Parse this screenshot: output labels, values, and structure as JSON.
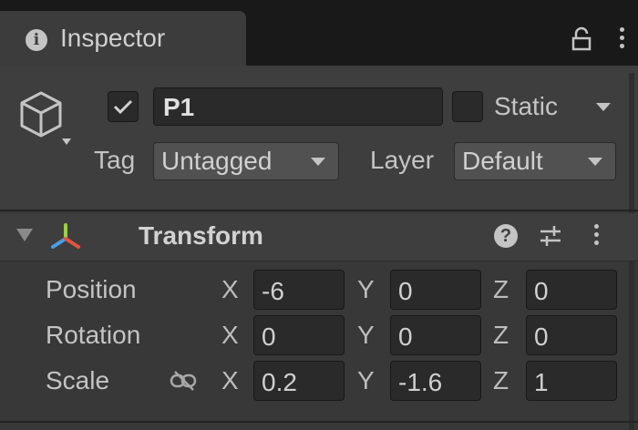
{
  "window": {
    "tab_title": "Inspector"
  },
  "header": {
    "object_name": "P1",
    "active": true,
    "static_label": "Static",
    "tag_label": "Tag",
    "tag_value": "Untagged",
    "layer_label": "Layer",
    "layer_value": "Default"
  },
  "transform": {
    "title": "Transform",
    "rows": [
      {
        "label": "Position",
        "x": "-6",
        "y": "0",
        "z": "0"
      },
      {
        "label": "Rotation",
        "x": "0",
        "y": "0",
        "z": "0"
      },
      {
        "label": "Scale",
        "x": "0.2",
        "y": "-1.6",
        "z": "1"
      }
    ],
    "axes": {
      "x": "X",
      "y": "Y",
      "z": "Z"
    }
  },
  "icons": {
    "tab": "info-icon",
    "lock": "lock-icon",
    "menu": "kebab-icon",
    "object": "gameobject-cube-icon",
    "foldout": "foldout-triangle-icon",
    "transform": "transform-axes-icon",
    "help": "help-icon",
    "presets": "presets-icon",
    "constrain": "constrain-proportions-icon"
  },
  "colors": {
    "axis_x": "#e5533d",
    "axis_y": "#9bd041",
    "axis_z": "#4a9fe3"
  }
}
